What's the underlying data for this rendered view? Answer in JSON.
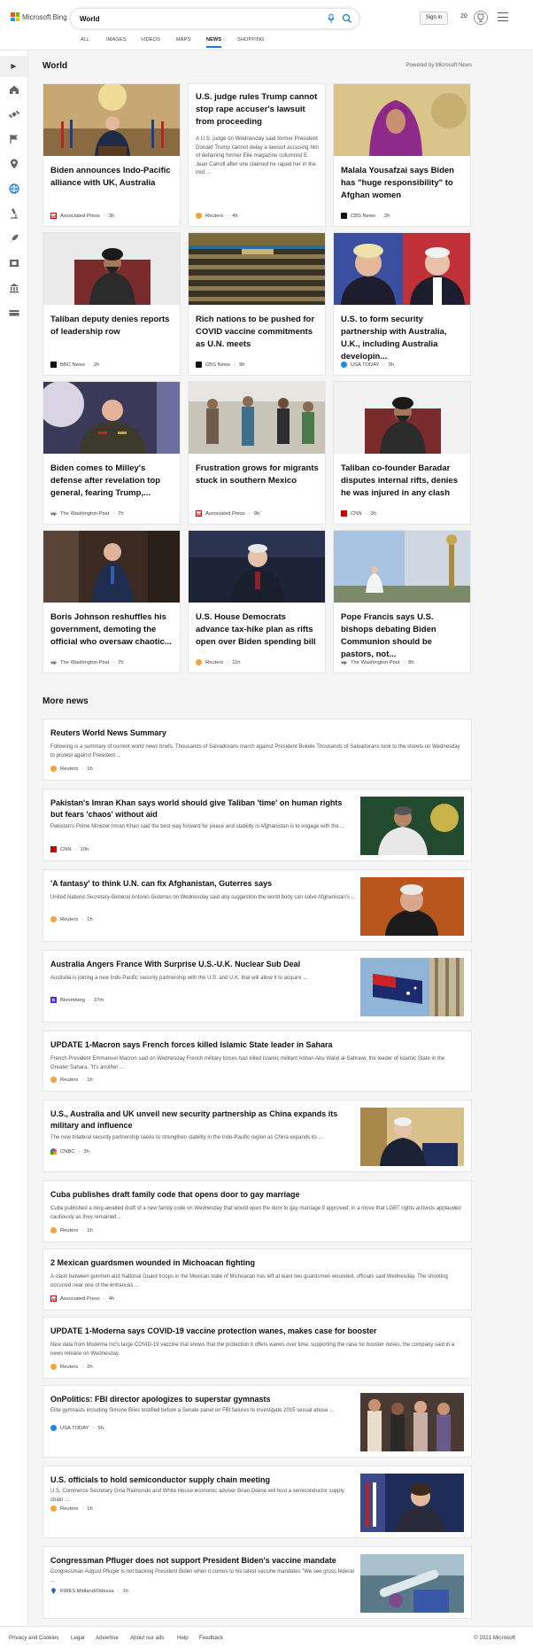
{
  "header": {
    "logo_text": "Microsoft Bing",
    "search_value": "World",
    "signin_label": "Sign in",
    "rewards_count": "20",
    "nav": [
      "ALL",
      "IMAGES",
      "VIDEOS",
      "MAPS",
      "NEWS",
      "SHOPPING"
    ],
    "active_nav": "NEWS"
  },
  "colors": {
    "accent": "#1a7cd6",
    "logo": [
      "#f25022",
      "#7fba00",
      "#00a4ef",
      "#ffb900"
    ]
  },
  "main": {
    "section_title": "World",
    "powered_by": "Powered by Microsoft News",
    "cards": [
      {
        "title": "Biden announces Indo-Pacific alliance with UK, Australia",
        "source": "Associated Press",
        "time": "3h"
      },
      {
        "title": "U.S. judge rules Trump cannot stop rape accuser's lawsuit from proceeding",
        "desc": "A U.S. judge on Wednesday said former President Donald Trump cannot delay a lawsuit accusing him of defaming former Elle magazine columnist E. Jean Carroll after she claimed he raped her in the mid ...",
        "source": "Reuters",
        "time": "4h"
      },
      {
        "title": "Malala Yousafzai says Biden has \"huge responsibility\" to Afghan women",
        "source": "CBS News",
        "time": "2h"
      },
      {
        "title": "Taliban deputy denies reports of leadership row",
        "source": "BBC News",
        "time": "2h"
      },
      {
        "title": "Rich nations to be pushed for COVID vaccine commitments as U.N. meets",
        "source": "CBS News",
        "time": "9h"
      },
      {
        "title": "U.S. to form security partnership with Australia, U.K., including Australia developin...",
        "source": "USA TODAY",
        "time": "3h"
      },
      {
        "title": "Biden comes to Milley's defense after revelation top general, fearing Trump,...",
        "source": "The Washington Post",
        "time": "7h"
      },
      {
        "title": "Frustration grows for migrants stuck in southern Mexico",
        "source": "Associated Press",
        "time": "9h"
      },
      {
        "title": "Taliban co-founder Baradar disputes internal rifts, denies he was injured in any clash",
        "source": "CNN",
        "time": "3h"
      },
      {
        "title": "Boris Johnson reshuffles his government, demoting the official who oversaw chaotic...",
        "source": "The Washington Post",
        "time": "7h"
      },
      {
        "title": "U.S. House Democrats advance tax-hike plan as rifts open over Biden spending bill",
        "source": "Reuters",
        "time": "11h"
      },
      {
        "title": "Pope Francis says U.S. bishops debating Biden Communion should be pastors, not...",
        "source": "The Washington Post",
        "time": "8h"
      }
    ]
  },
  "more_news": {
    "title": "More news",
    "items": [
      {
        "title": "Reuters World News Summary",
        "snippet": "Following is a summary of current world news briefs. Thousands of Salvadorans march against President Bukele Thousands of Salvadorans took to the streets on Wednesday to protest against President ...",
        "source": "Reuters",
        "time": "1h"
      },
      {
        "title": "Pakistan's Imran Khan says world should give Taliban 'time' on human rights but fears 'chaos' without aid",
        "snippet": "Pakistan's Prime Minister Imran Khan said the best way forward for peace and stability in Afghanistan is to engage with the ...",
        "source": "CNN",
        "time": "10h"
      },
      {
        "title": "'A fantasy' to think U.N. can fix Afghanistan, Guterres says",
        "snippet": "United Nations Secretary-General Antonio Guterres on Wednesday said any suggestion the world body can solve Afghanistan's ...",
        "source": "Reuters",
        "time": "1h"
      },
      {
        "title": "Australia Angers France With Surprise U.S.-U.K. Nuclear Sub Deal",
        "snippet": "Australia is joining a new Indo-Pacific security partnership with the U.S. and U.K. that will allow it to acquire ...",
        "source": "Bloomberg",
        "time": "37m"
      },
      {
        "title": "UPDATE 1-Macron says French forces killed Islamic State leader in Sahara",
        "snippet": "French President Emmanuel Macron said on Wednesday French military forces had killed Islamic militant Adnan Abu Walid al-Sahrawi, the leader of Islamic State in the Greater Sahara. \"It's another ...",
        "source": "Reuters",
        "time": "1h"
      },
      {
        "title": "U.S., Australia and UK unveil new security partnership as China expands its military and influence",
        "snippet": "The new trilateral security partnership seeks to strengthen stability in the Indo-Pacific region as China expands its ...",
        "source": "CNBC",
        "time": "3h"
      },
      {
        "title": "Cuba publishes draft family code that opens door to gay marriage",
        "snippet": "Cuba published a long-awaited draft of a new family code on Wednesday that would open the door to gay marriage if approved, in a move that LGBT rights activists applauded cautiously as they remained ...",
        "source": "Reuters",
        "time": "1h"
      },
      {
        "title": "2 Mexican guardsmen wounded in Michoacan fighting",
        "snippet": "A clash between gunmen and National Guard troops in the Mexican state of Michoacan has left at least two guardsmen wounded, officials said Wednesday. The shooting occurred near one of the entrances ...",
        "source": "Associated Press",
        "time": "4h"
      },
      {
        "title": "UPDATE 1-Moderna says COVID-19 vaccine protection wanes, makes case for booster",
        "snippet": "New data from Moderna Inc's large COVID-19 vaccine trial shows that the protection it offers wanes over time, supporting the case for booster doses, the company said in a news release on Wednesday.",
        "source": "Reuters",
        "time": "2h"
      },
      {
        "title": "OnPolitics: FBI director apologizes to superstar gymnasts",
        "snippet": "Elite gymnasts including Simone Biles testified before a Senate panel on FBI failures to investigate 2015 sexual abuse ...",
        "source": "USA TODAY",
        "time": "5h"
      },
      {
        "title": "U.S. officials to hold semiconductor supply chain meeting",
        "snippet": "U.S. Commerce Secretary Gina Raimondo and White House economic adviser Brian Deese will host a semiconductor supply chain ...",
        "source": "Reuters",
        "time": "1h"
      },
      {
        "title": "Congressman Pfluger does not support President Biden's vaccine mandate",
        "snippet": "Congressman August Pfluger is not backing President Biden when it comes to his latest vaccine mandates \"We see gross federal ...",
        "source": "KWES Midland/Odessa",
        "time": "1h"
      }
    ]
  },
  "footer": {
    "links": [
      "Privacy and Cookies",
      "Legal",
      "Advertise",
      "About our ads",
      "Help",
      "Feedback"
    ],
    "copyright": "© 2021 Microsoft"
  }
}
